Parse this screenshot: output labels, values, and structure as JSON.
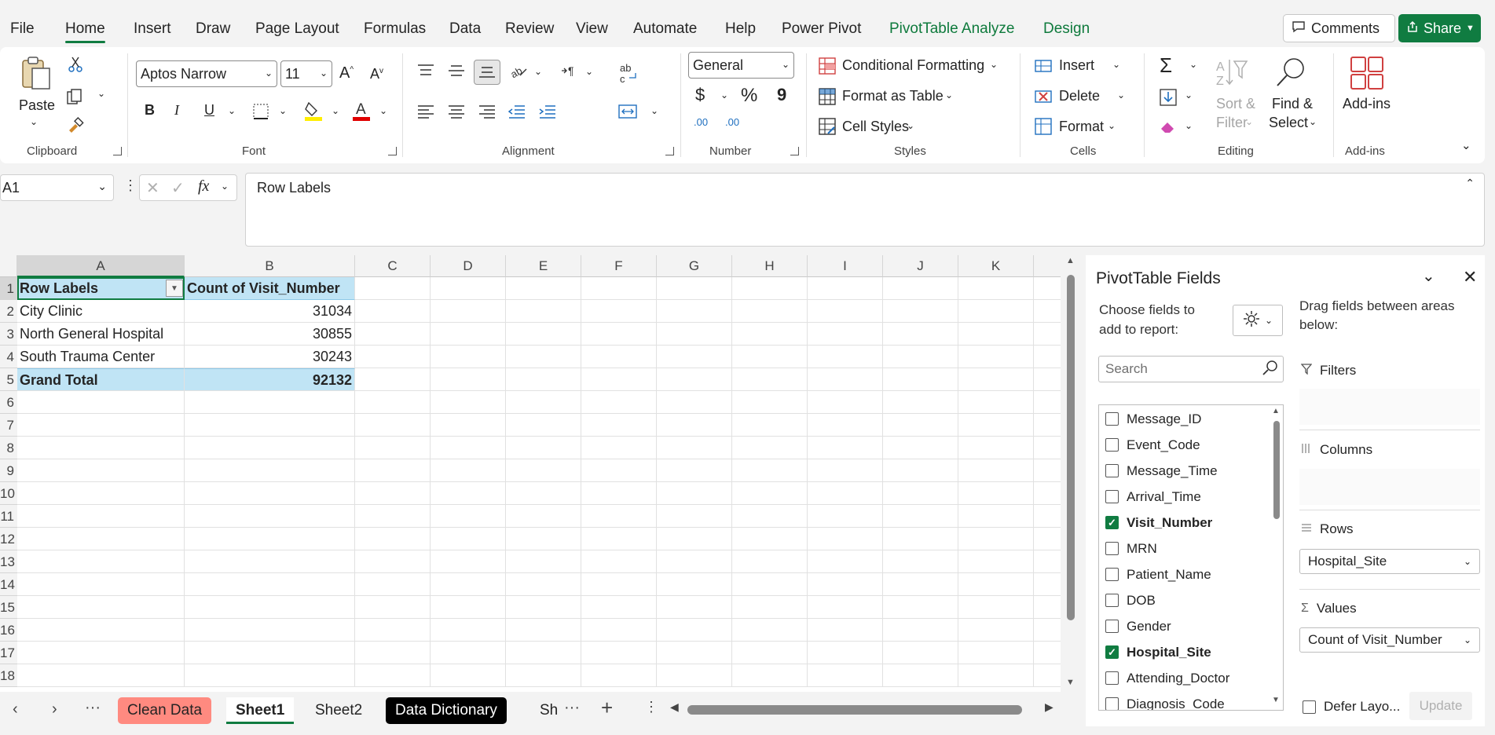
{
  "menu": {
    "tabs": [
      {
        "label": "File"
      },
      {
        "label": "Home"
      },
      {
        "label": "Insert"
      },
      {
        "label": "Draw"
      },
      {
        "label": "Page Layout"
      },
      {
        "label": "Formulas"
      },
      {
        "label": "Data"
      },
      {
        "label": "Review"
      },
      {
        "label": "View"
      },
      {
        "label": "Automate"
      },
      {
        "label": "Help"
      },
      {
        "label": "Power Pivot"
      },
      {
        "label": "PivotTable Analyze"
      },
      {
        "label": "Design"
      }
    ],
    "comments_label": "Comments",
    "share_label": "Share"
  },
  "ribbon": {
    "clipboard": {
      "paste": "Paste",
      "group": "Clipboard"
    },
    "font": {
      "name": "Aptos Narrow",
      "size": "11",
      "group": "Font",
      "bold": "B",
      "italic": "I",
      "underline": "U"
    },
    "alignment": {
      "group": "Alignment"
    },
    "number": {
      "format": "General",
      "group": "Number",
      "currency": "$",
      "percent": "%",
      "comma": "9",
      "inc_decimal": ".00",
      "dec_decimal": ".00"
    },
    "styles": {
      "conditional": "Conditional Formatting",
      "format_table": "Format as Table",
      "cell_styles": "Cell Styles",
      "group": "Styles"
    },
    "cells": {
      "insert": "Insert",
      "delete": "Delete",
      "format": "Format",
      "group": "Cells"
    },
    "editing": {
      "sort_filter_1": "Sort &",
      "sort_filter_2": "Filter",
      "find_select_1": "Find &",
      "find_select_2": "Select",
      "group": "Editing"
    },
    "addins": {
      "label": "Add-ins",
      "group": "Add-ins"
    }
  },
  "formula_bar": {
    "name_box": "A1",
    "formula": "Row Labels"
  },
  "grid": {
    "columns": [
      "A",
      "B",
      "C",
      "D",
      "E",
      "F",
      "G",
      "H",
      "I",
      "J",
      "K"
    ],
    "rows": [
      "1",
      "2",
      "3",
      "4",
      "5",
      "6",
      "7",
      "8",
      "9",
      "10",
      "11",
      "12",
      "13",
      "14",
      "15",
      "16",
      "17",
      "18"
    ],
    "row_label_header": "Row Labels",
    "value_header": "Count of Visit_Number",
    "data": [
      {
        "label": "City Clinic",
        "value": "31034"
      },
      {
        "label": "North General Hospital",
        "value": "30855"
      },
      {
        "label": "South Trauma Center",
        "value": "30243"
      }
    ],
    "total_label": "Grand Total",
    "total_value": "92132"
  },
  "sheets": {
    "tabs": [
      {
        "label": "Clean Data",
        "color": "#ff8a80"
      },
      {
        "label": "Sheet1",
        "active": true
      },
      {
        "label": "Sheet2"
      },
      {
        "label": "Data Dictionary",
        "color": "#000000"
      },
      {
        "label": "Sh"
      }
    ]
  },
  "pivot_panel": {
    "title": "PivotTable Fields",
    "choose_1": "Choose fields to",
    "choose_2": "add to report:",
    "drag_1": "Drag fields between areas",
    "drag_2": "below:",
    "search_placeholder": "Search",
    "fields": [
      {
        "name": "Message_ID",
        "checked": false
      },
      {
        "name": "Event_Code",
        "checked": false
      },
      {
        "name": "Message_Time",
        "checked": false
      },
      {
        "name": "Arrival_Time",
        "checked": false
      },
      {
        "name": "Visit_Number",
        "checked": true
      },
      {
        "name": "MRN",
        "checked": false
      },
      {
        "name": "Patient_Name",
        "checked": false
      },
      {
        "name": "DOB",
        "checked": false
      },
      {
        "name": "Gender",
        "checked": false
      },
      {
        "name": "Hospital_Site",
        "checked": true
      },
      {
        "name": "Attending_Doctor",
        "checked": false
      },
      {
        "name": "Diagnosis_Code",
        "checked": false
      }
    ],
    "areas": {
      "filters": "Filters",
      "columns": "Columns",
      "rows": "Rows",
      "rows_value": "Hospital_Site",
      "values": "Values",
      "values_value": "Count of Visit_Number"
    },
    "defer_label": "Defer Layo...",
    "update_label": "Update"
  },
  "colors": {
    "accent": "#107c41",
    "pivot_header": "#c0e4f5"
  }
}
